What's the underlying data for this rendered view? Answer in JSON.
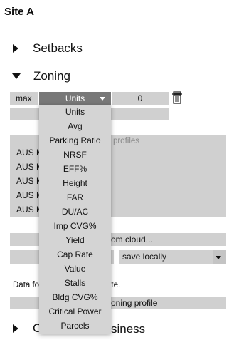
{
  "site": {
    "title": "Site A"
  },
  "sections": {
    "setbacks": {
      "label": "Setbacks"
    },
    "zoning": {
      "label": "Zoning"
    },
    "business": {
      "label_left": "C",
      "label_right": "siness"
    }
  },
  "zoning": {
    "rule": {
      "type_value": "max",
      "units_value": "Units",
      "amount_value": "0"
    },
    "profiles_placeholder_visible": "lt profiles",
    "profiles": [
      "AUS M",
      "AUS M",
      "AUS M",
      "AUS M",
      "AUS M"
    ],
    "load_from_cloud_visible": "om cloud...",
    "save_select_value": "save locally",
    "data_note_left": "Data fo",
    "data_note_right": "ate.",
    "zoning_profile_button_visible": "oning profile"
  },
  "units_dropdown": {
    "options": [
      "Units",
      "Avg",
      "Parking Ratio",
      "NRSF",
      "EFF%",
      "Height",
      "FAR",
      "DU/AC",
      "Imp CVG%",
      "Yield",
      "Cap Rate",
      "Value",
      "Stalls",
      "Bldg CVG%",
      "Critical Power",
      "Parcels"
    ]
  },
  "icons": {
    "delete": "trash-icon",
    "expand": "triangle-right-icon",
    "collapse": "triangle-down-icon",
    "dropdown": "caret-down-icon"
  },
  "colors": {
    "field_bg": "#d0d0d0",
    "selected_select_bg": "#787878",
    "dropdown_bg": "#d4d4d4"
  }
}
